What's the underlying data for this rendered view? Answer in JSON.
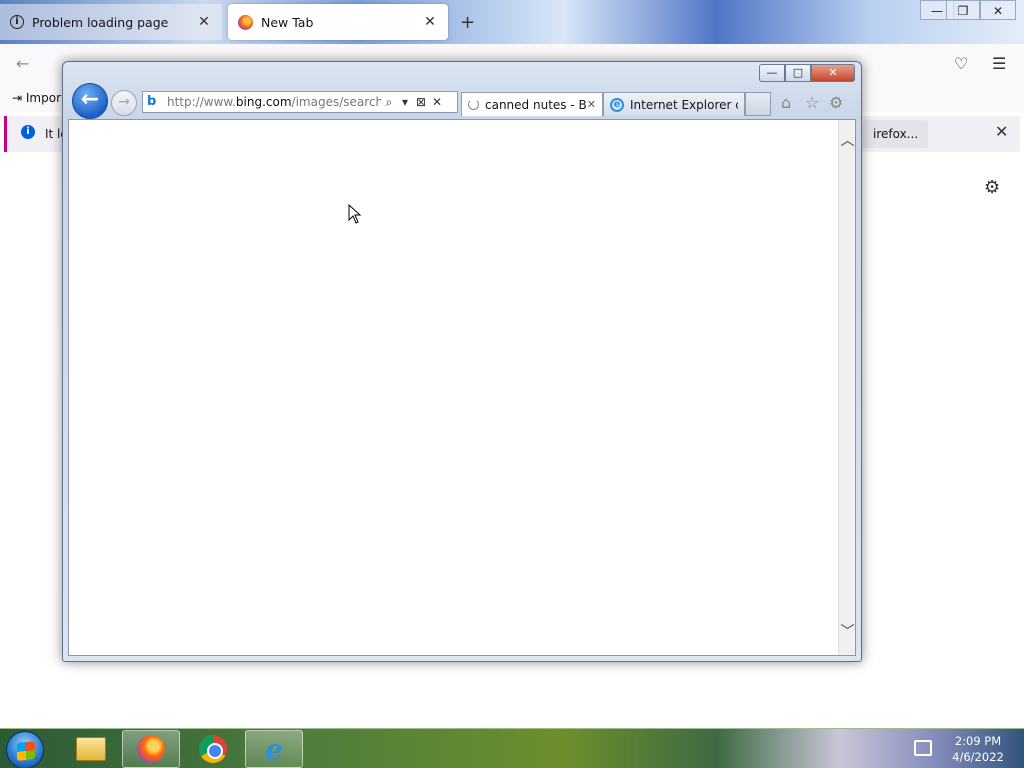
{
  "firefox": {
    "tabs": [
      {
        "title": "Problem loading page",
        "active": false
      },
      {
        "title": "New Tab",
        "active": true
      }
    ],
    "new_tab_glyph": "+",
    "window_controls": {
      "minimize": "—",
      "restore": "❐",
      "close": "✕"
    },
    "bookmark_import": "Impor",
    "infobar": {
      "message": "It lo",
      "button_label": "irefox...",
      "close": "✕"
    }
  },
  "ie": {
    "address": {
      "prefix": "http://www.",
      "domain": "bing.com",
      "path": "/images/search?q="
    },
    "tabs": [
      {
        "title": "canned nutes - B...",
        "active": true
      },
      {
        "title": "Internet Explorer ca...",
        "active": false
      }
    ],
    "caption": {
      "minimize": "—",
      "maximize": "□",
      "close": "✕"
    }
  },
  "taskbar": {
    "time": "2:09 PM",
    "date": "4/6/2022",
    "ie_glyph": "e"
  }
}
